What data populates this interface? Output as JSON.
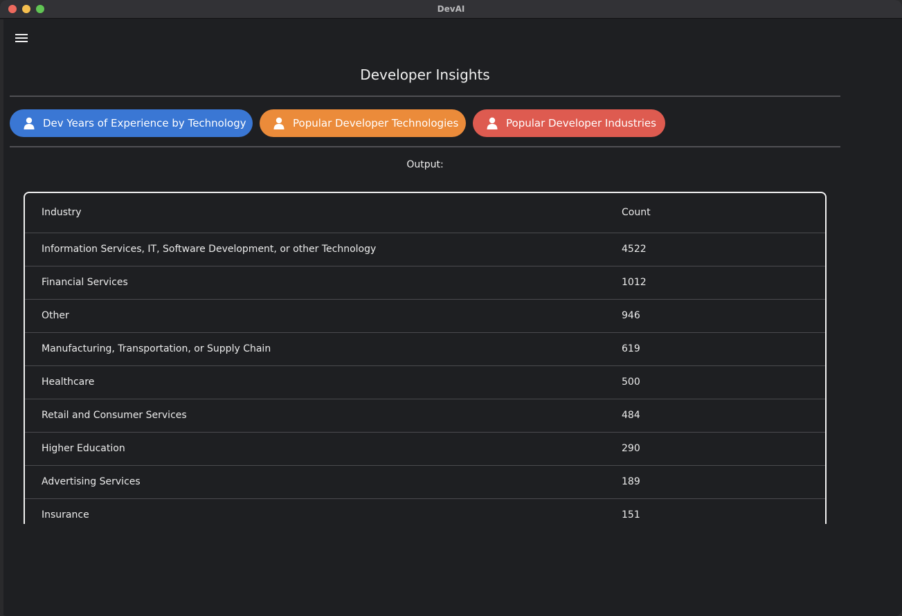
{
  "window": {
    "title": "DevAI"
  },
  "page": {
    "title": "Developer Insights",
    "output_label": "Output:"
  },
  "menu": {
    "icon": "hamburger-menu-icon"
  },
  "actions": [
    {
      "label": "Dev Years of Experience by Technology",
      "icon": "user-icon",
      "color": "#3a77d4"
    },
    {
      "label": "Popular Developer Technologies",
      "icon": "user-icon",
      "color": "#eb8b3a"
    },
    {
      "label": "Popular Developer Industries",
      "icon": "user-icon",
      "color": "#de5b50"
    }
  ],
  "table": {
    "headers": [
      "Industry",
      "Count"
    ],
    "rows": [
      [
        "Information Services, IT, Software Development, or other Technology",
        "4522"
      ],
      [
        "Financial Services",
        "1012"
      ],
      [
        "Other",
        "946"
      ],
      [
        "Manufacturing, Transportation, or Supply Chain",
        "619"
      ],
      [
        "Healthcare",
        "500"
      ],
      [
        "Retail and Consumer Services",
        "484"
      ],
      [
        "Higher Education",
        "290"
      ],
      [
        "Advertising Services",
        "189"
      ],
      [
        "Insurance",
        "151"
      ]
    ]
  }
}
